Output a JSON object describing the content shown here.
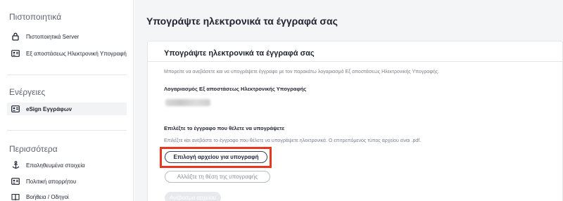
{
  "sidebar": {
    "certificates_title": "Πιστοποιητικά",
    "certificates_items": [
      {
        "label": "Πιστοποιητικά Server",
        "icon": "lock-icon"
      },
      {
        "label": "Εξ αποστάσεως Ηλεκτρονική Υπογραφή",
        "icon": "id-card-icon"
      }
    ],
    "actions_title": "Ενέργειες",
    "actions_items": [
      {
        "label": "eSign Εγγράφων",
        "icon": "id-card-icon",
        "active": true
      }
    ],
    "more_title": "Περισσότερα",
    "more_items": [
      {
        "label": "Επαληθευμένα στοιχεία",
        "icon": "anchor-icon"
      },
      {
        "label": "Πολιτική απορρήτου",
        "icon": "id-card-icon"
      },
      {
        "label": "Βοήθεια / Οδηγοί",
        "icon": "book-icon"
      }
    ]
  },
  "main": {
    "page_title": "Υπογράψτε ηλεκτρονικά τα έγγραφά σας",
    "card": {
      "title": "Υπογράψτε ηλεκτρονικά τα έγγραφά σας",
      "intro": "Μπορείτε να ανεβάσετε και να υπογράψετε έγγραφο με τον παρακάτω λογαριασμό Εξ αποστάσεως Ηλεκτρονικής Υπογραφής.",
      "account_label": "Λογαριασμός Εξ αποστάσεως Ηλεκτρονικής Υπογραφής",
      "select_label": "Επιλέξτε το έγγραφο που θέλετε να υπογράψετε",
      "select_desc": "Επιλέξτε και ανεβάστε το έγγραφο που θέλετε να υπογράψετε ηλεκτρονικά. Ο επιτρεπόμενος τύπος αρχείου είναι .pdf.",
      "choose_file_button": "Επιλογή αρχείου για υπογραφή",
      "change_position_button": "Αλλάξτε τη θέση της υπογραφής",
      "upload_button": "Ανέβασμα αρχείου"
    }
  },
  "colors": {
    "highlight": "#e8361f",
    "background": "#f4f5f7"
  }
}
